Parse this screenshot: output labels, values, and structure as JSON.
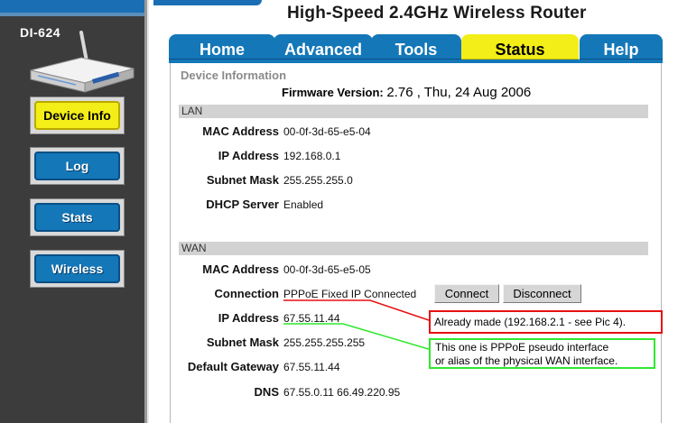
{
  "header": {
    "title": "High-Speed 2.4GHz Wireless Router"
  },
  "sidebar": {
    "model": "DI-624",
    "items": [
      {
        "label": "Device Info",
        "active": true
      },
      {
        "label": "Log",
        "active": false
      },
      {
        "label": "Stats",
        "active": false
      },
      {
        "label": "Wireless",
        "active": false
      }
    ]
  },
  "tabs": [
    {
      "label": "Home",
      "active": false
    },
    {
      "label": "Advanced",
      "active": false
    },
    {
      "label": "Tools",
      "active": false
    },
    {
      "label": "Status",
      "active": true
    },
    {
      "label": "Help",
      "active": false
    }
  ],
  "device_info": {
    "section_title": "Device Information",
    "firmware_label": "Firmware Version:",
    "firmware_value": "2.76 , Thu, 24 Aug 2006"
  },
  "lan": {
    "title": "LAN",
    "mac_label": "MAC Address",
    "mac": "00-0f-3d-65-e5-04",
    "ip_label": "IP Address",
    "ip": "192.168.0.1",
    "mask_label": "Subnet Mask",
    "mask": "255.255.255.0",
    "dhcp_label": "DHCP Server",
    "dhcp": "Enabled"
  },
  "wan": {
    "title": "WAN",
    "mac_label": "MAC Address",
    "mac": "00-0f-3d-65-e5-05",
    "conn_label": "Connection",
    "conn_type": "PPPoE Fixed IP",
    "conn_status": "Connected",
    "connect_btn": "Connect",
    "disconnect_btn": "Disconnect",
    "ip_label": "IP Address",
    "ip": "67.55.11.44",
    "mask_label": "Subnet Mask",
    "mask": "255.255.255.255",
    "gw_label": "Default Gateway",
    "gw": "67.55.11.44",
    "dns_label": "DNS",
    "dns": "67.55.0.11 66.49.220.95"
  },
  "annotations": {
    "red": "Already made (192.168.2.1 - see Pic 4).",
    "green_line1": "This one is PPPoE pseudo interface",
    "green_line2": "or alias of the physical WAN interface."
  },
  "colors": {
    "tab_blue": "#1477b8",
    "active_yellow": "#f4ee18",
    "annotation_red": "#e61010",
    "annotation_green": "#2ee82e"
  }
}
